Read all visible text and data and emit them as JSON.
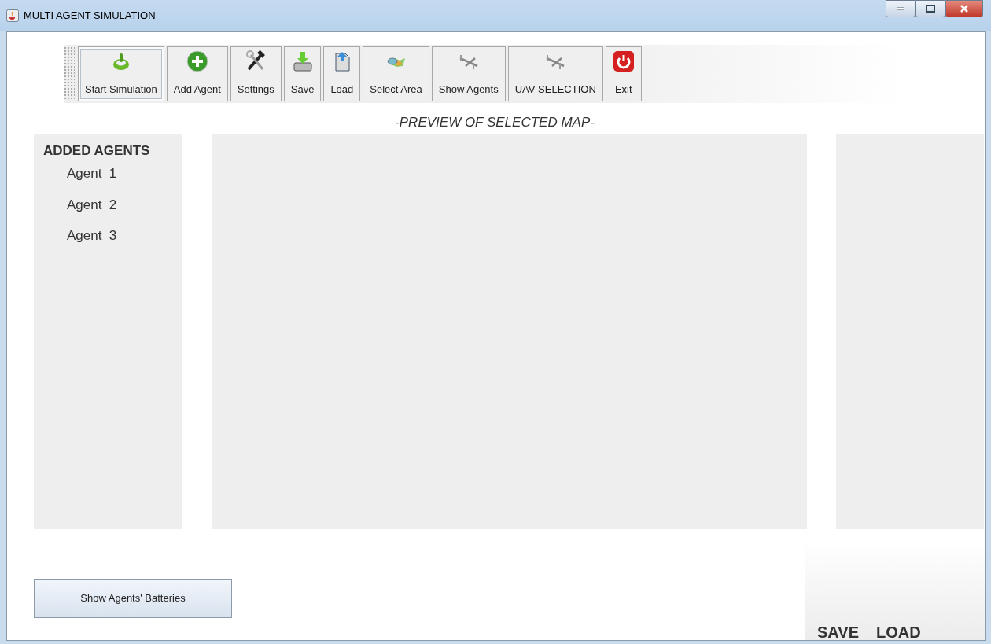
{
  "window": {
    "title": "MULTI AGENT SIMULATION"
  },
  "toolbar": [
    {
      "label": "Start Simulation",
      "kind": "start",
      "selected": true
    },
    {
      "label": "Add Agent",
      "kind": "add",
      "selected": false
    },
    {
      "label_parts": [
        {
          "text": "S",
          "underlined": false
        },
        {
          "text": "e",
          "underlined": true
        },
        {
          "text": "ttings",
          "underlined": false
        }
      ],
      "kind": "settings",
      "selected": false
    },
    {
      "label_parts": [
        {
          "text": "Sav",
          "underlined": false
        },
        {
          "text": "e",
          "underlined": true
        }
      ],
      "kind": "save",
      "selected": false
    },
    {
      "label": "Load",
      "kind": "load",
      "selected": false
    },
    {
      "label": "Select Area",
      "kind": "area",
      "selected": false
    },
    {
      "label": "Show Agents",
      "kind": "agents",
      "selected": false
    },
    {
      "label": "UAV SELECTION",
      "kind": "uav",
      "selected": false
    },
    {
      "label_parts": [
        {
          "text": "E",
          "underlined": true
        },
        {
          "text": "xit",
          "underlined": false
        }
      ],
      "kind": "exit",
      "selected": false
    }
  ],
  "map_preview": {
    "title": "-PREVIEW OF SELECTED MAP-"
  },
  "agents_panel": {
    "title": "ADDED AGENTS",
    "items": [
      "Agent  1",
      "Agent  2",
      "Agent  3"
    ]
  },
  "batteries_button": "Show Agents' Batteries",
  "corner_panel": {
    "labels": [
      "SAVE",
      "LOAD"
    ]
  }
}
